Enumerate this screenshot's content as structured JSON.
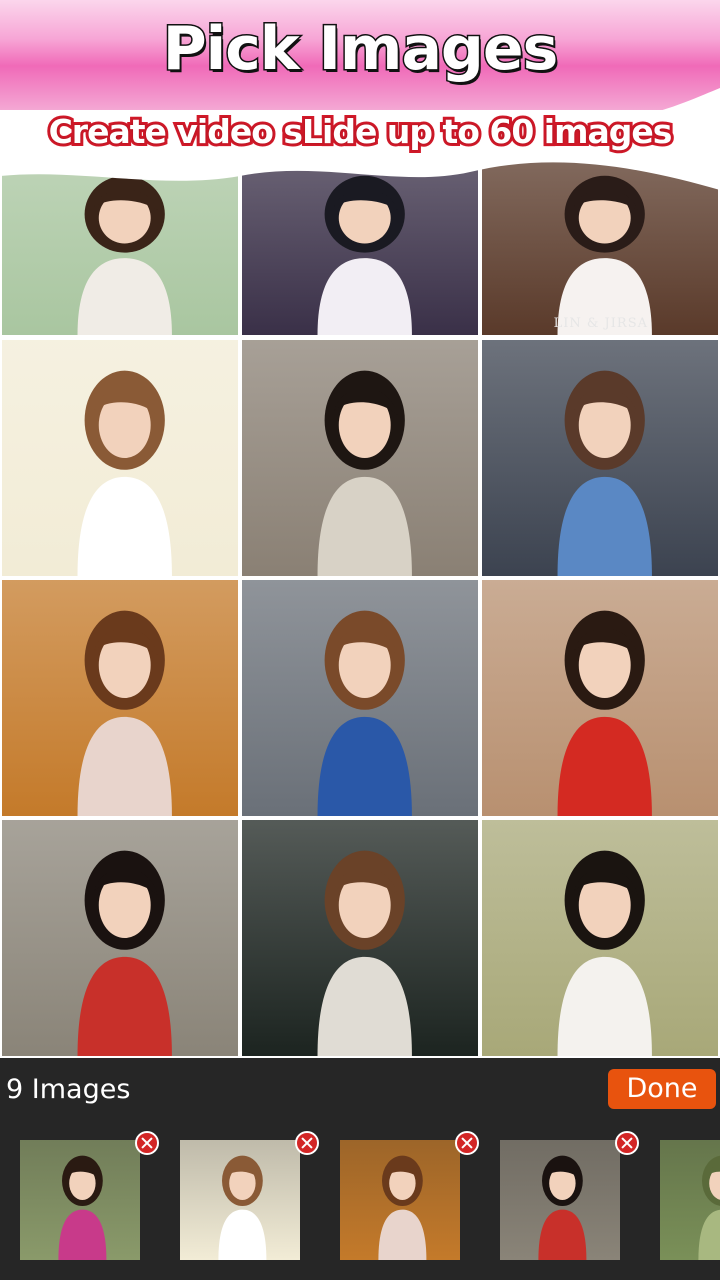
{
  "header": {
    "title": "Pick Images",
    "subtitle": "Create video sLide up to 60 images"
  },
  "grid": {
    "watermark": "LIN & JIRSA",
    "photos": [
      {
        "name": "photo-girl-pinwheel",
        "bg": "#a9c6a0",
        "accent": "#f0ece6",
        "hair": "#3a2418"
      },
      {
        "name": "photo-wedding-pier",
        "bg": "#3a3048",
        "accent": "#f2eef4",
        "hair": "#1a1a22"
      },
      {
        "name": "photo-wedding-couple",
        "bg": "#5a3a2a",
        "accent": "#f6f2f0",
        "hair": "#2a1c18"
      },
      {
        "name": "photo-girl-white-dress",
        "bg": "#f2ecd6",
        "accent": "#ffffff",
        "hair": "#8a5a36"
      },
      {
        "name": "photo-girl-earmuffs",
        "bg": "#8a8074",
        "accent": "#d8d2c6",
        "hair": "#1e1612"
      },
      {
        "name": "photo-girl-blue-coat",
        "bg": "#3c4350",
        "accent": "#5a88c4",
        "hair": "#5a3a2a"
      },
      {
        "name": "photo-girl-sitting-autumn",
        "bg": "#c47a2a",
        "accent": "#e8d4cc",
        "hair": "#6a3a1c"
      },
      {
        "name": "photo-girl-denim-shirt",
        "bg": "#6a7078",
        "accent": "#2a58a8",
        "hair": "#7a4a2a"
      },
      {
        "name": "photo-girl-red-polka",
        "bg": "#b89070",
        "accent": "#d42a22",
        "hair": "#2a1a12"
      },
      {
        "name": "photo-girl-red-qipao",
        "bg": "#8a8478",
        "accent": "#c8302a",
        "hair": "#1a1210"
      },
      {
        "name": "photo-girl-red-scarf",
        "bg": "#1c2420",
        "accent": "#e0dcd4",
        "hair": "#6a4228"
      },
      {
        "name": "photo-girl-field",
        "bg": "#a8a878",
        "accent": "#f4f2ee",
        "hair": "#1a1410"
      }
    ]
  },
  "tray": {
    "count_label": "9 Images",
    "done_label": "Done",
    "selected": [
      {
        "name": "selected-girl-pink-dress",
        "bg": "#8a9a6a",
        "accent": "#c83a8a",
        "hair": "#2a1a12"
      },
      {
        "name": "selected-girl-white-dress",
        "bg": "#f2ecd6",
        "accent": "#ffffff",
        "hair": "#8a5a36"
      },
      {
        "name": "selected-girl-sitting-autumn",
        "bg": "#c47a2a",
        "accent": "#e8d4cc",
        "hair": "#6a3a1c"
      },
      {
        "name": "selected-girl-red-qipao",
        "bg": "#8a8478",
        "accent": "#c8302a",
        "hair": "#1a1210"
      },
      {
        "name": "selected-field-grass",
        "bg": "#7a9058",
        "accent": "#a8b880",
        "hair": "#5a6a3a"
      }
    ]
  },
  "colors": {
    "header_pink": "#f06ab8",
    "header_light": "#fbd6ec",
    "tray_bg": "#262626",
    "done_orange": "#e8530e",
    "remove_red": "#d32626"
  }
}
